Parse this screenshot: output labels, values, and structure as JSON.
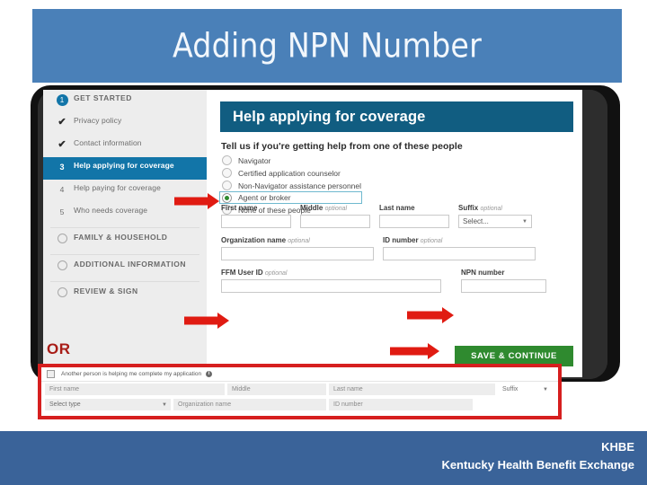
{
  "slide": {
    "title": "Adding NPN Number"
  },
  "nav": {
    "items": [
      {
        "marker": "1",
        "marker_type": "badge",
        "label": "GET STARTED",
        "style": "cap",
        "active": false
      },
      {
        "marker": "check",
        "marker_type": "check",
        "label": "Privacy policy",
        "style": "normal",
        "active": false
      },
      {
        "marker": "check",
        "marker_type": "check",
        "label": "Contact information",
        "style": "normal",
        "active": false
      },
      {
        "marker": "3",
        "marker_type": "number",
        "label": "Help applying for coverage",
        "style": "normal",
        "active": true
      },
      {
        "marker": "4",
        "marker_type": "number",
        "label": "Help paying for coverage",
        "style": "normal",
        "active": false
      },
      {
        "marker": "5",
        "marker_type": "number",
        "label": "Who needs coverage",
        "style": "normal",
        "active": false
      },
      {
        "marker": "ring",
        "marker_type": "ring",
        "label": "FAMILY & HOUSEHOLD",
        "style": "cap",
        "active": false
      },
      {
        "marker": "ring",
        "marker_type": "ring",
        "label": "ADDITIONAL INFORMATION",
        "style": "cap",
        "active": false
      },
      {
        "marker": "ring",
        "marker_type": "ring",
        "label": "REVIEW & SIGN",
        "style": "cap",
        "active": false
      }
    ]
  },
  "content": {
    "header": "Help applying for coverage",
    "prompt": "Tell us if you're getting help from one of these people",
    "radios": [
      {
        "label": "Navigator",
        "selected": false,
        "highlighted": false
      },
      {
        "label": "Certified application counselor",
        "selected": false,
        "highlighted": false
      },
      {
        "label": "Non-Navigator assistance personnel",
        "selected": false,
        "highlighted": false
      },
      {
        "label": "Agent or broker",
        "selected": true,
        "highlighted": true
      },
      {
        "label": "None of these people",
        "selected": false,
        "highlighted": false
      }
    ],
    "fields_row1": [
      {
        "label": "First name",
        "optional": "",
        "type": "text",
        "value": ""
      },
      {
        "label": "Middle",
        "optional": "optional",
        "type": "text",
        "value": ""
      },
      {
        "label": "Last name",
        "optional": "",
        "type": "text",
        "value": ""
      },
      {
        "label": "Suffix",
        "optional": "optional",
        "type": "select",
        "value": "Select..."
      }
    ],
    "fields_row2": [
      {
        "label": "Organization name",
        "optional": "optional",
        "type": "text",
        "value": ""
      },
      {
        "label": "ID number",
        "optional": "optional",
        "type": "text",
        "value": ""
      }
    ],
    "fields_row3": [
      {
        "label": "FFM User ID",
        "optional": "optional",
        "type": "text",
        "value": ""
      },
      {
        "label": "NPN number",
        "optional": "",
        "type": "text",
        "value": ""
      }
    ],
    "save_button": "SAVE & CONTINUE"
  },
  "annotations": {
    "or_label": "OR",
    "arrow_color": "#e01b12"
  },
  "bottom_panel": {
    "checkbox_label": "Another person is helping me complete my application",
    "info_icon": "i",
    "row1": [
      {
        "placeholder": "First name",
        "type": "text"
      },
      {
        "placeholder": "Middle",
        "type": "text"
      },
      {
        "placeholder": "Last name",
        "type": "text"
      },
      {
        "placeholder": "Suffix",
        "type": "select"
      }
    ],
    "row2": [
      {
        "placeholder": "Select type",
        "type": "select"
      },
      {
        "placeholder": "Organization name",
        "type": "text"
      },
      {
        "placeholder": "ID number",
        "type": "text"
      }
    ]
  },
  "footer": {
    "line1": "KHBE",
    "line2": "Kentucky Health Benefit Exchange"
  }
}
